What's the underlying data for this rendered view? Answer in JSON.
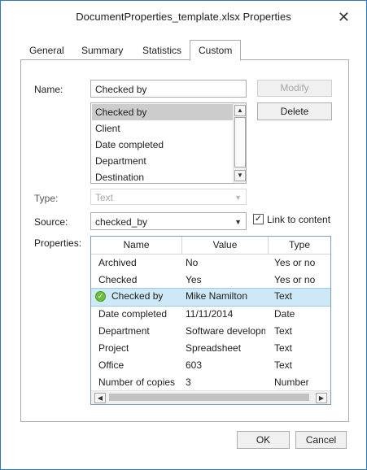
{
  "window": {
    "title": "DocumentProperties_template.xlsx Properties",
    "close_glyph": "✕"
  },
  "tabs": [
    {
      "label": "General"
    },
    {
      "label": "Summary"
    },
    {
      "label": "Statistics"
    },
    {
      "label": "Custom",
      "active": true
    }
  ],
  "form": {
    "name_label": "Name:",
    "name_value": "Checked by",
    "modify_label": "Modify",
    "delete_label": "Delete",
    "name_list": [
      "Checked by",
      "Client",
      "Date completed",
      "Department",
      "Destination"
    ],
    "type_label": "Type:",
    "type_value": "Text",
    "source_label": "Source:",
    "source_value": "checked_by",
    "link_label": "Link to content",
    "link_checked": true,
    "properties_label": "Properties:"
  },
  "properties_table": {
    "headers": [
      "Name",
      "Value",
      "Type"
    ],
    "rows": [
      {
        "name": "Archived",
        "value": "No",
        "type": "Yes or no"
      },
      {
        "name": "Checked",
        "value": "Yes",
        "type": "Yes or no"
      },
      {
        "name": "Checked by",
        "value": "Mike Namilton",
        "type": "Text",
        "selected": true
      },
      {
        "name": "Date completed",
        "value": "11/11/2014",
        "type": "Date"
      },
      {
        "name": "Department",
        "value": "Software development",
        "type": "Text"
      },
      {
        "name": "Project",
        "value": "Spreadsheet",
        "type": "Text"
      },
      {
        "name": "Office",
        "value": "603",
        "type": "Text"
      },
      {
        "name": "Number of copies",
        "value": "3",
        "type": "Number"
      }
    ]
  },
  "footer": {
    "ok_label": "OK",
    "cancel_label": "Cancel"
  },
  "colors": {
    "accent_border": "#2b78c8",
    "selection": "#cde8f6",
    "list_selection": "#cccccc"
  }
}
